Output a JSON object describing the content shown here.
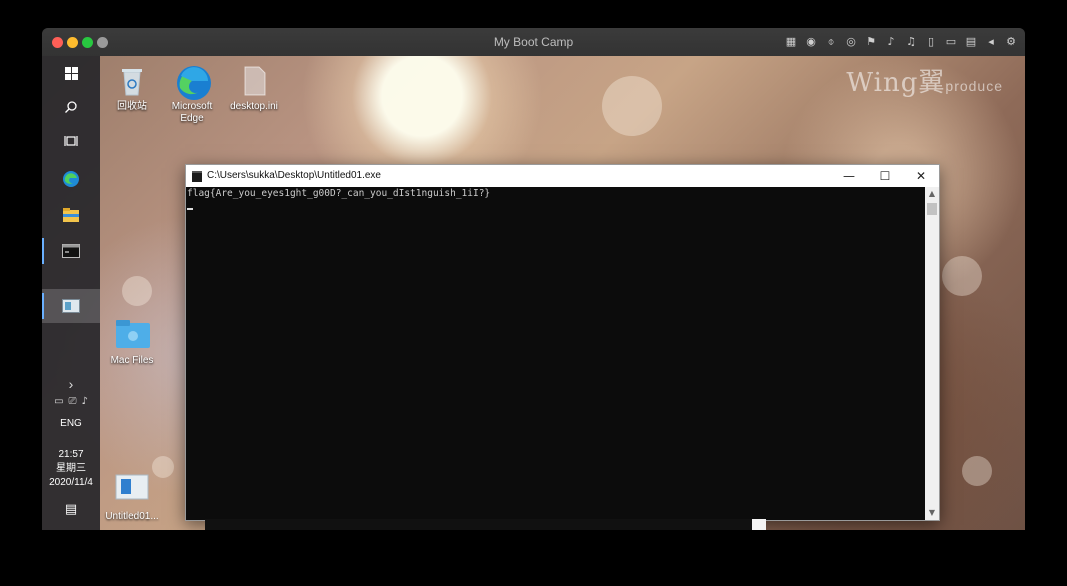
{
  "host": {
    "title": "My Boot Camp",
    "toolbar_icons": [
      "keyboard-icon",
      "cd-icon",
      "usb-icon",
      "record-icon",
      "network-icon",
      "speaker-icon",
      "microphone-icon",
      "tablet-icon",
      "screen-icon",
      "folder-icon",
      "arrow-left-icon",
      "gear-icon"
    ],
    "toolbar_glyphs": [
      "▦",
      "◉",
      "⌽",
      "◎",
      "⚑",
      "♪",
      "♫",
      "▯",
      "▭",
      "▤",
      "◂",
      "⚙"
    ]
  },
  "watermark": {
    "main": "Wing",
    "ideo": "翼",
    "sub": "produce"
  },
  "taskbar": {
    "tray_glyphs": [
      "▭",
      "⎚",
      "♪"
    ],
    "language": "ENG",
    "time": "21:57",
    "weekday": "星期三",
    "date": "2020/11/4",
    "notification_glyph": "▤",
    "expand_glyph": "›"
  },
  "desktop_icons": [
    {
      "label": "回收站"
    },
    {
      "label": "Microsoft Edge"
    },
    {
      "label": "desktop.ini"
    },
    {
      "label": "Mac Files"
    },
    {
      "label": "Untitled01..."
    }
  ],
  "console": {
    "title": "C:\\Users\\sukka\\Desktop\\Untitled01.exe",
    "output": "flag{Are_you_eyes1ght_g00D?_can_you_dIst1nguish_1iI?}",
    "min_glyph": "—",
    "max_glyph": "☐",
    "close_glyph": "✕",
    "scroll_up_glyph": "▲",
    "scroll_down_glyph": "▼"
  }
}
